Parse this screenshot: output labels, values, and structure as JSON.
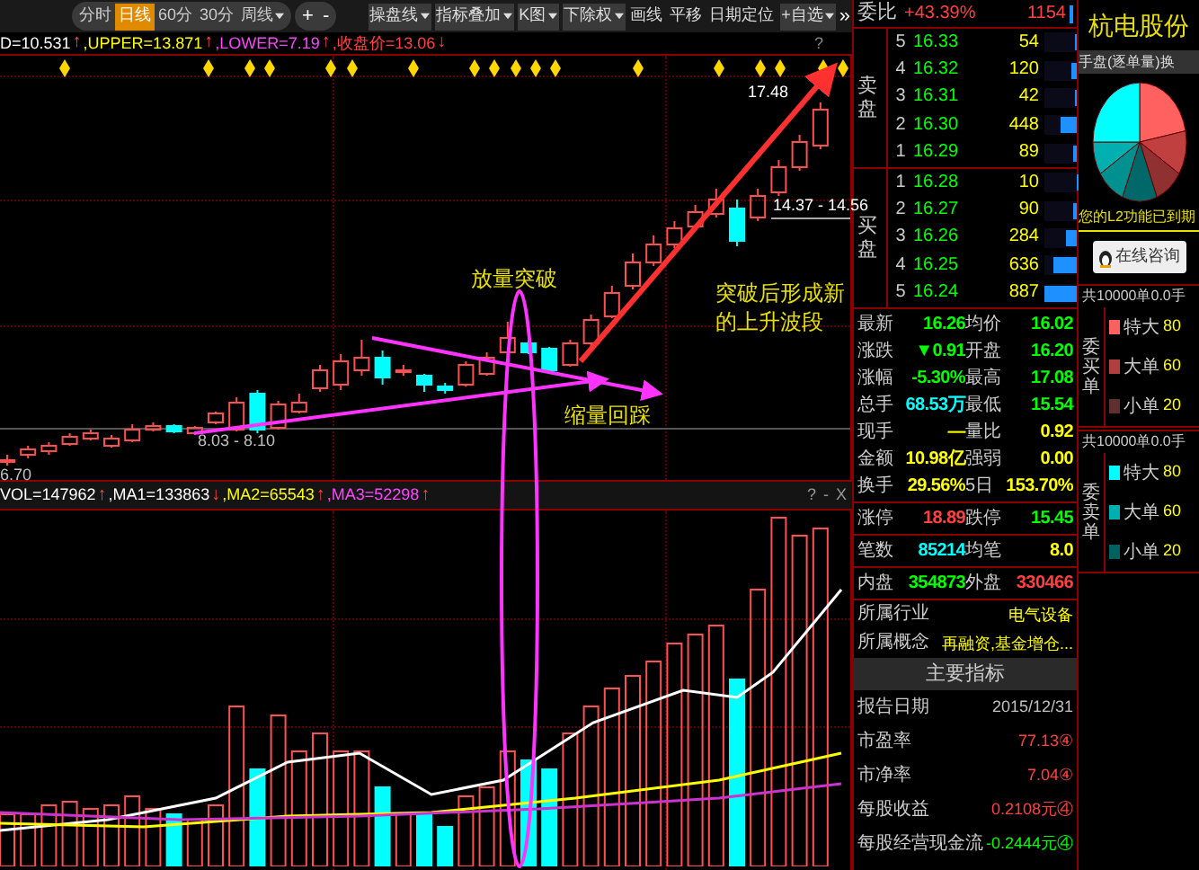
{
  "toolbar": {
    "view_tabs": [
      {
        "label": "分时",
        "selected": false,
        "dropdown": false
      },
      {
        "label": "日线",
        "selected": true,
        "dropdown": false
      },
      {
        "label": "60分",
        "selected": false,
        "dropdown": false
      },
      {
        "label": "30分",
        "selected": false,
        "dropdown": false
      },
      {
        "label": "周线",
        "selected": false,
        "dropdown": true
      }
    ],
    "zoom_buttons": [
      "+",
      "-"
    ],
    "tools": [
      {
        "label": "操盘线",
        "dropdown": true
      },
      {
        "label": "指标叠加",
        "dropdown": true
      },
      {
        "label": "K图",
        "dropdown": true
      },
      {
        "label": "下除权",
        "dropdown": true
      },
      {
        "label": "画线",
        "dropdown": false
      },
      {
        "label": "平移",
        "dropdown": false
      },
      {
        "label": "日期定位",
        "dropdown": false
      },
      {
        "label": "+自选",
        "dropdown": true
      }
    ],
    "more": "»"
  },
  "indicator_line": {
    "items": [
      {
        "text": "D=10.531",
        "color": "#ffffff",
        "arrow": "↑"
      },
      {
        "text": ",UPPER=13.871",
        "color": "#ffff00",
        "arrow": "↑"
      },
      {
        "text": ",LOWER=7.19",
        "color": "#ff44ff",
        "arrow": "↑"
      },
      {
        "text": ",收盘价=13.06",
        "color": "#ff4040",
        "arrow": "↓"
      }
    ],
    "help": "?"
  },
  "chart": {
    "labels": [
      "17.48",
      "14.37 - 14.56",
      "8.03 - 8.10",
      "6.70"
    ],
    "annotations": [
      "放量突破",
      "缩量回踩",
      "突破后形成新的上升波段"
    ]
  },
  "volume_header": {
    "items": [
      {
        "text": "VOL=147962",
        "color": "#ffffff",
        "arrow": "↑"
      },
      {
        "text": ",MA1=133863",
        "color": "#ffffff",
        "arrow": "↓"
      },
      {
        "text": ",MA2=65543",
        "color": "#ffff00",
        "arrow": "↑"
      },
      {
        "text": ",MA3=52298",
        "color": "#ff44ff",
        "arrow": "↑"
      }
    ],
    "controls": [
      "?",
      "-",
      "X"
    ]
  },
  "quote": {
    "weibi": {
      "label": "委比",
      "value": "+43.39%",
      "count": "1154"
    },
    "sell": {
      "label": "卖盘",
      "rows": [
        {
          "index": "5",
          "price": "16.33",
          "volume": "54",
          "level": 0.06
        },
        {
          "index": "4",
          "price": "16.32",
          "volume": "120",
          "level": 0.14
        },
        {
          "index": "3",
          "price": "16.31",
          "volume": "42",
          "level": 0.05
        },
        {
          "index": "2",
          "price": "16.30",
          "volume": "448",
          "level": 0.5
        },
        {
          "index": "1",
          "price": "16.29",
          "volume": "89",
          "level": 0.1
        }
      ]
    },
    "buy": {
      "label": "买盘",
      "rows": [
        {
          "index": "1",
          "price": "16.28",
          "volume": "10",
          "level": 0.01
        },
        {
          "index": "2",
          "price": "16.27",
          "volume": "90",
          "level": 0.1
        },
        {
          "index": "3",
          "price": "16.26",
          "volume": "284",
          "level": 0.32
        },
        {
          "index": "4",
          "price": "16.25",
          "volume": "636",
          "level": 0.72
        },
        {
          "index": "5",
          "price": "16.24",
          "volume": "887",
          "level": 1
        }
      ]
    },
    "groups": [
      [
        [
          {
            "label": "最新",
            "value": "16.26",
            "color": "#00ff00"
          },
          {
            "label": "均价",
            "value": "16.02",
            "color": "#00ff00"
          }
        ],
        [
          {
            "label": "涨跌",
            "value": "▼0.91",
            "color": "#00ff00"
          },
          {
            "label": "开盘",
            "value": "16.20",
            "color": "#00ff00"
          }
        ],
        [
          {
            "label": "涨幅",
            "value": "-5.30%",
            "color": "#00ff00"
          },
          {
            "label": "最高",
            "value": "17.08",
            "color": "#00ff00"
          }
        ],
        [
          {
            "label": "总手",
            "value": "68.53万",
            "color": "#00ffff"
          },
          {
            "label": "最低",
            "value": "15.54",
            "color": "#00ff00"
          }
        ],
        [
          {
            "label": "现手",
            "value": "—",
            "color": "#ffff00"
          },
          {
            "label": "量比",
            "value": "0.92",
            "color": "#ffff00"
          }
        ],
        [
          {
            "label": "金额",
            "value": "10.98亿",
            "color": "#ffff00"
          },
          {
            "label": "强弱",
            "value": "0.00",
            "color": "#ffff00"
          }
        ],
        [
          {
            "label": "换手",
            "value": "29.56%",
            "color": "#ffff00"
          },
          {
            "label": "5日",
            "value": "153.70%",
            "color": "#ffff00"
          }
        ]
      ],
      [
        [
          {
            "label": "涨停",
            "value": "18.89",
            "color": "#ff4040"
          },
          {
            "label": "跌停",
            "value": "15.45",
            "color": "#00ff00"
          }
        ]
      ],
      [
        [
          {
            "label": "笔数",
            "value": "85214",
            "color": "#00ffff"
          },
          {
            "label": "均笔",
            "value": "8.0",
            "color": "#ffff00"
          }
        ]
      ],
      [
        [
          {
            "label": "内盘",
            "value": "354873",
            "color": "#00ff00"
          },
          {
            "label": "外盘",
            "value": "330466",
            "color": "#ff4040"
          }
        ]
      ]
    ],
    "info": [
      {
        "label": "所属行业",
        "value": "电气设备"
      },
      {
        "label": "所属概念",
        "value": "再融资,基金增仓..."
      }
    ],
    "indicators_title": "主要指标",
    "indicators": [
      {
        "label": "报告日期",
        "value": "2015/12/31",
        "color": "#c0c0c0"
      },
      {
        "label": "市盈率",
        "value": "77.13④",
        "color": "#ff4040"
      },
      {
        "label": "市净率",
        "value": "7.04④",
        "color": "#ff4040"
      },
      {
        "label": "每股收益",
        "value": "0.2108元④",
        "color": "#ff4040"
      },
      {
        "label": "每股经营现金流",
        "value": "-0.2444元④",
        "color": "#00ff00"
      }
    ]
  },
  "stock_panel": {
    "title": "杭电股份",
    "tab": "手盘(逐单量)换",
    "notice": "您的L2功能已到期",
    "consult_button": "在线咨询",
    "sections": [
      {
        "header": "共10000单0.0手",
        "side_label": "委买单",
        "rows": [
          {
            "label": "特大",
            "value": "80",
            "color": "#ff6060"
          },
          {
            "label": "大单",
            "value": "60",
            "color": "#b04040"
          },
          {
            "label": "小单",
            "value": "20",
            "color": "#603030"
          }
        ]
      },
      {
        "header": "共10000单0.0手",
        "side_label": "委卖单",
        "rows": [
          {
            "label": "特大",
            "value": "80",
            "color": "#00ffff"
          },
          {
            "label": "大单",
            "value": "60",
            "color": "#00b0b0"
          },
          {
            "label": "小单",
            "value": "20",
            "color": "#006060"
          }
        ]
      }
    ]
  }
}
